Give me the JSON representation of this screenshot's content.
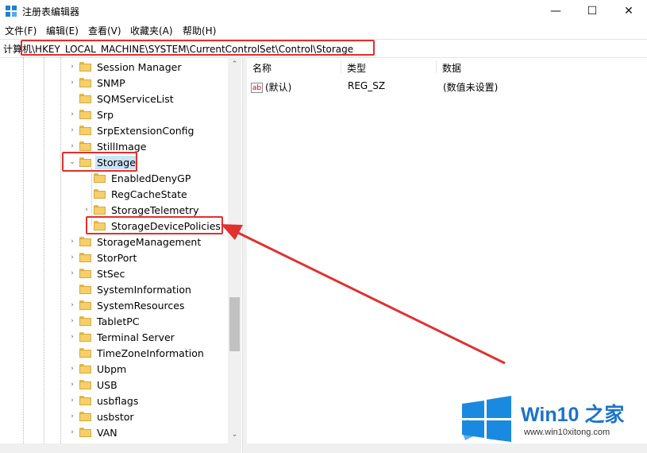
{
  "window": {
    "title": "注册表编辑器",
    "minimize_glyph": "—",
    "maximize_glyph": "☐",
    "close_glyph": "✕"
  },
  "menu": {
    "items": [
      "文件(F)",
      "编辑(E)",
      "查看(V)",
      "收藏夹(A)",
      "帮助(H)"
    ]
  },
  "address": {
    "path": "计算机\\HKEY_LOCAL_MACHINE\\SYSTEM\\CurrentControlSet\\Control\\Storage"
  },
  "tree": {
    "items": [
      {
        "label": "Session Manager"
      },
      {
        "label": "SNMP"
      },
      {
        "label": "SQMServiceList"
      },
      {
        "label": "Srp"
      },
      {
        "label": "SrpExtensionConfig"
      },
      {
        "label": "StillImage"
      },
      {
        "label": "Storage"
      },
      {
        "label": "EnabledDenyGP"
      },
      {
        "label": "RegCacheState"
      },
      {
        "label": "StorageTelemetry"
      },
      {
        "label": "StorageDevicePolicies"
      },
      {
        "label": "StorageManagement"
      },
      {
        "label": "StorPort"
      },
      {
        "label": "StSec"
      },
      {
        "label": "SystemInformation"
      },
      {
        "label": "SystemResources"
      },
      {
        "label": "TabletPC"
      },
      {
        "label": "Terminal Server"
      },
      {
        "label": "TimeZoneInformation"
      },
      {
        "label": "Ubpm"
      },
      {
        "label": "USB"
      },
      {
        "label": "usbflags"
      },
      {
        "label": "usbstor"
      },
      {
        "label": "VAN"
      }
    ],
    "collapsed_glyph": "›",
    "expanded_glyph": "⌄"
  },
  "list": {
    "headers": {
      "name": "名称",
      "type": "类型",
      "data": "数据"
    },
    "rows": [
      {
        "icon_text": "ab",
        "name": "(默认)",
        "type": "REG_SZ",
        "data": "(数值未设置)"
      }
    ]
  },
  "scroll": {
    "up_glyph": "⌃",
    "down_glyph": "⌄"
  },
  "watermark": {
    "title": "Win10 之家",
    "url": "www.win10xitong.com"
  },
  "colors": {
    "highlight_red": "#e03030",
    "selection_blue": "#cce4f7",
    "watermark_blue": "#1a73c9"
  }
}
